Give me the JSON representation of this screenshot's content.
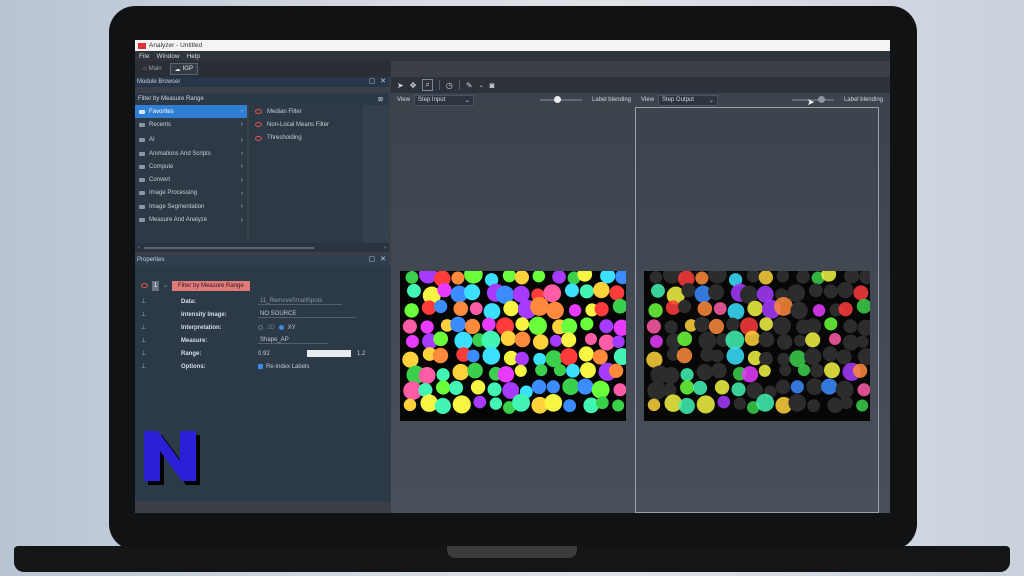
{
  "window": {
    "title": "Analyzer - Untitled"
  },
  "menu": [
    "File",
    "Window",
    "Help"
  ],
  "toolbar": {
    "main_label": "Main",
    "igp_label": "IGP"
  },
  "module_browser": {
    "title": "Module Browser",
    "filter_text": "Filter by Measure Range",
    "categories": [
      {
        "label": "Favorites",
        "selected": true
      },
      {
        "label": "Recents"
      },
      {
        "label": "AI"
      },
      {
        "label": "Animations And Scripts"
      },
      {
        "label": "Compute"
      },
      {
        "label": "Convert"
      },
      {
        "label": "Image Processing"
      },
      {
        "label": "Image Segmentation"
      },
      {
        "label": "Measure And Analyze"
      }
    ],
    "modules": [
      "Median Filter",
      "Non-Local Means Filter",
      "Thresholding"
    ]
  },
  "properties": {
    "title": "Properties",
    "module_index": "1",
    "module_name": "Filter by Measure Range",
    "rows": {
      "data_label": "Data:",
      "data_value": "11_RemoveSmallSpots",
      "intensity_label": "Intensity Image:",
      "intensity_value": "NO SOURCE",
      "interp_label": "Interpretation:",
      "interp_3d": "3D",
      "interp_xy": "XY",
      "measure_label": "Measure:",
      "measure_value": "Shape_AP",
      "range_label": "Range:",
      "range_min": "0.92",
      "range_max": "1.2",
      "options_label": "Options:",
      "options_value": "Re-index Labels"
    }
  },
  "views": {
    "left": {
      "view_label": "View",
      "step": "Step Input",
      "blend_label": "Label blending"
    },
    "right": {
      "view_label": "View",
      "step": "Step Output",
      "blend_label": "Label blending"
    }
  },
  "colors": {
    "accent": "#2f7fd4",
    "module_badge": "#e37a7a",
    "logo": "#2b1fd8"
  }
}
